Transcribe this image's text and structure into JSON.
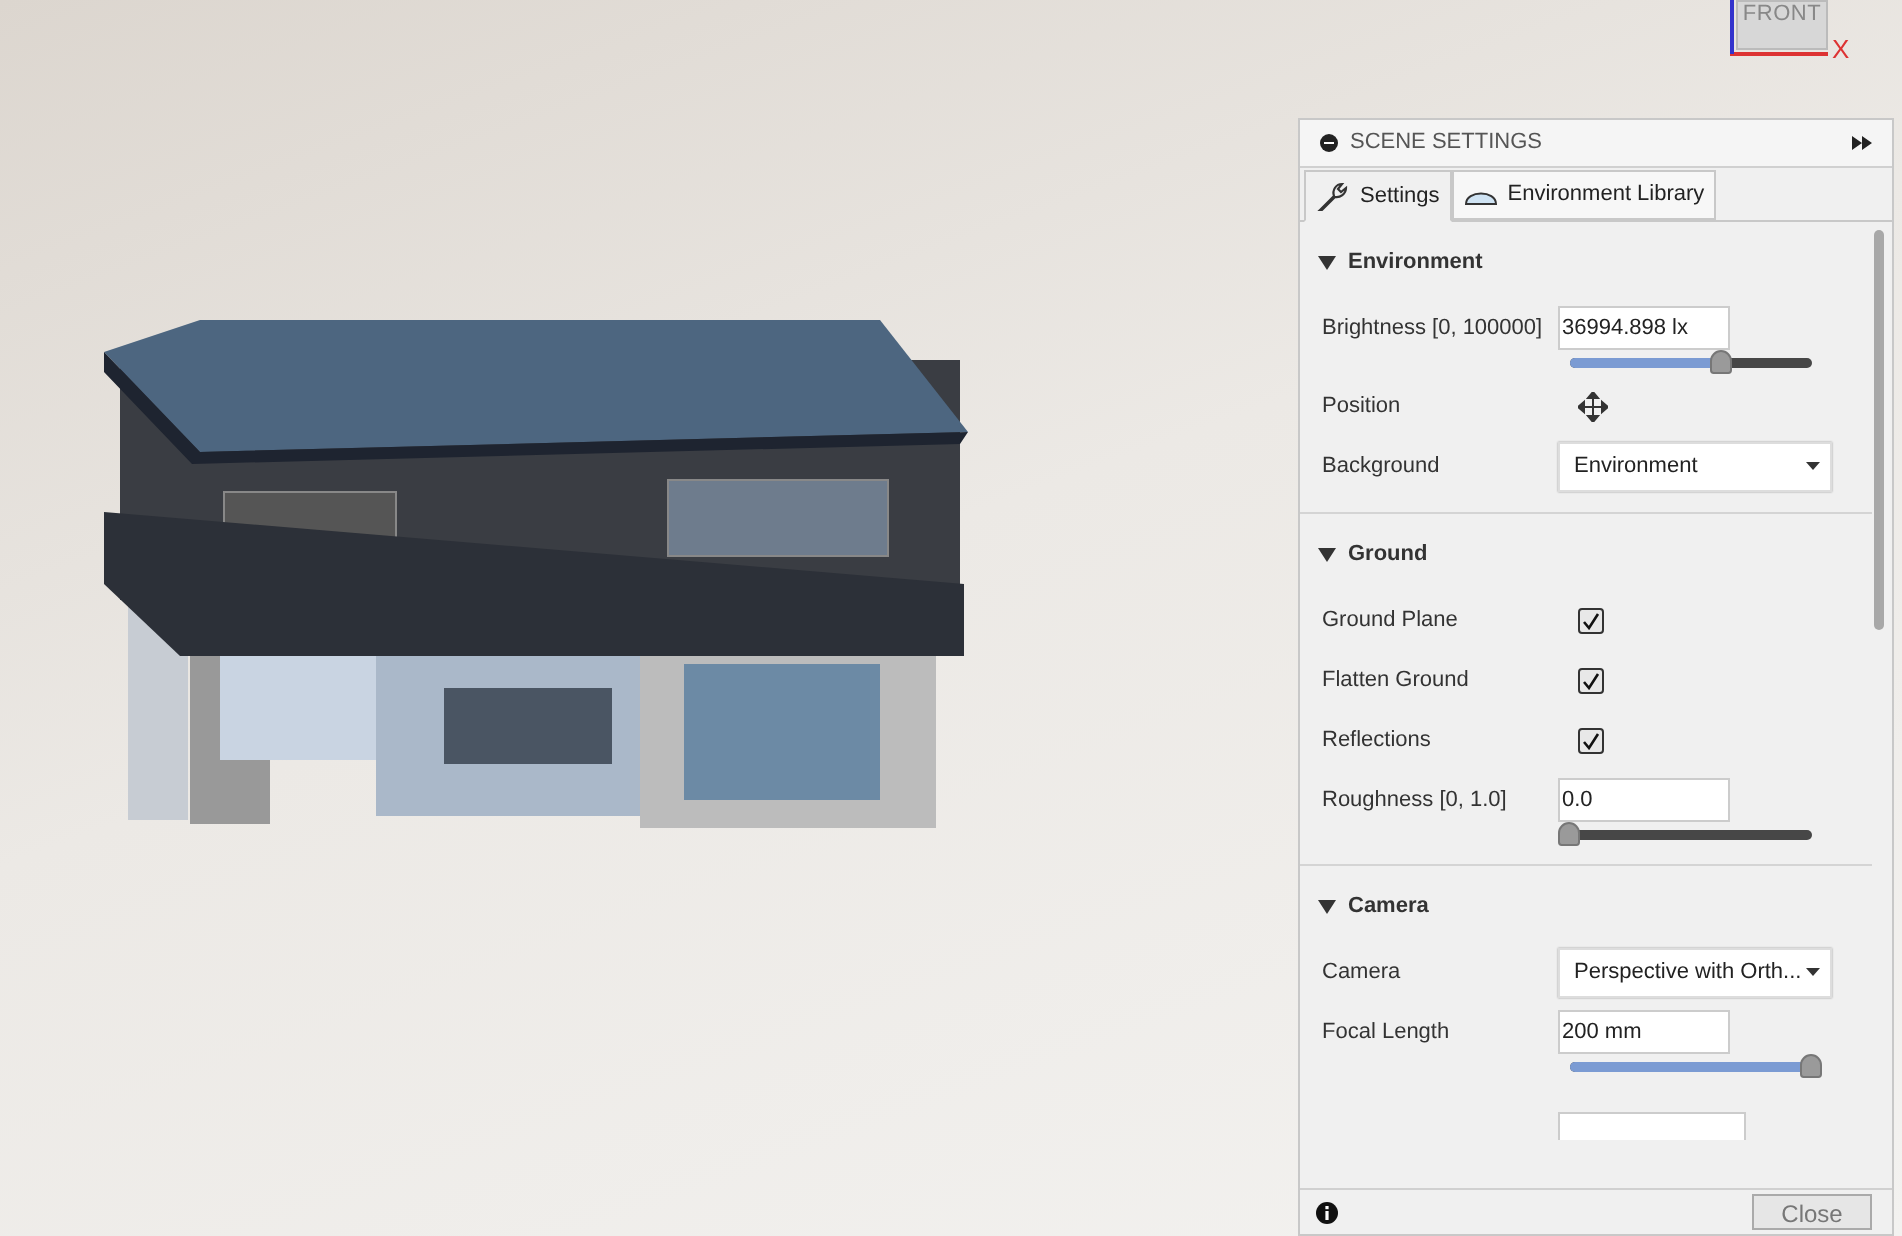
{
  "viewcube": {
    "face": "FRONT",
    "axis": "X"
  },
  "panel": {
    "title": "SCENE SETTINGS",
    "tabs": [
      {
        "label": "Settings",
        "selected": true
      },
      {
        "label": "Environment Library",
        "selected": false
      }
    ],
    "sections": [
      {
        "title": "Environment",
        "expanded": true,
        "rows": [
          {
            "kind": "slider",
            "label": "Brightness [0, 100000]",
            "value": "36994.898 lx",
            "level": 0.63
          },
          {
            "kind": "move",
            "label": "Position"
          },
          {
            "kind": "dropdown",
            "label": "Background",
            "value": "Environment"
          }
        ]
      },
      {
        "title": "Ground",
        "expanded": true,
        "rows": [
          {
            "kind": "checkbox",
            "label": "Ground Plane",
            "checked": true
          },
          {
            "kind": "checkbox",
            "label": "Flatten Ground",
            "checked": true
          },
          {
            "kind": "checkbox",
            "label": "Reflections",
            "checked": true
          },
          {
            "kind": "slider",
            "label": "Roughness [0, 1.0]",
            "value": "0.0",
            "level": 0
          }
        ]
      },
      {
        "title": "Camera",
        "expanded": true,
        "rows": [
          {
            "kind": "dropdown",
            "label": "Camera",
            "value": "Perspective with Orth..."
          },
          {
            "kind": "slider",
            "label": "Focal Length",
            "value": "200 mm",
            "level": 1
          }
        ]
      }
    ],
    "close": "Close"
  }
}
